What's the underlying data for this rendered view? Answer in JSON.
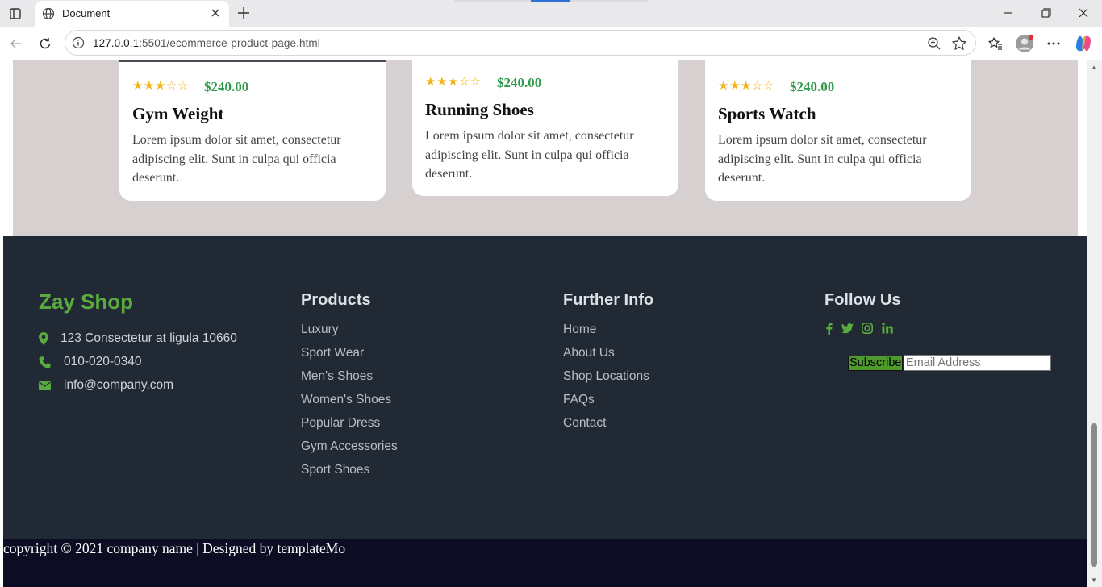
{
  "browser": {
    "tab_title": "Document",
    "url_host": "127.0.0.1",
    "url_rest": ":5501/ecommerce-product-page.html",
    "icons": [
      "tab-actions-icon",
      "globe-icon",
      "close-icon",
      "new-tab-icon",
      "minimize-icon",
      "restore-icon",
      "window-close-icon",
      "back-icon",
      "reload-icon",
      "site-info-icon",
      "zoom-icon",
      "favorite-star-icon",
      "favorites-icon",
      "profile-icon",
      "more-icon",
      "copilot-icon"
    ]
  },
  "products": [
    {
      "stars": "★★★☆☆",
      "price": "$240.00",
      "name": "Gym Weight",
      "description": "Lorem ipsum dolor sit amet, consectetur adipiscing elit. Sunt in culpa qui officia deserunt.",
      "rating": 3
    },
    {
      "stars": "★★★☆☆",
      "price": "$240.00",
      "name": "Running Shoes",
      "description": "Lorem ipsum dolor sit amet, consectetur adipiscing elit. Sunt in culpa qui officia deserunt.",
      "rating": 3
    },
    {
      "stars": "★★★☆☆",
      "price": "$240.00",
      "name": "Sports Watch",
      "description": "Lorem ipsum dolor sit amet, consectetur adipiscing elit. Sunt in culpa qui officia deserunt.",
      "rating": 3
    }
  ],
  "footer": {
    "brand": "Zay Shop",
    "contact": {
      "address": "123 Consectetur at ligula 10660",
      "phone": "010-020-0340",
      "email": "info@company.com"
    },
    "products_title": "Products",
    "products_links": [
      "Luxury",
      "Sport Wear",
      "Men's Shoes",
      "Women's Shoes",
      "Popular Dress",
      "Gym Accessories",
      "Sport Shoes"
    ],
    "info_title": "Further Info",
    "info_links": [
      "Home",
      "About Us",
      "Shop Locations",
      "FAQs",
      "Contact"
    ],
    "follow_title": "Follow Us",
    "social_icons": [
      "facebook-icon",
      "twitter-icon",
      "instagram-icon",
      "linkedin-icon"
    ],
    "subscribe_label": "Subscribe",
    "email_placeholder": "Email Address",
    "copyright": "copyright © 2021 company name | Designed by templateMo"
  },
  "colors": {
    "accent_green": "#59ab3f",
    "price_green": "#2e9a49",
    "star_yellow": "#f2b51c",
    "footer_bg": "#212934",
    "copyright_bg": "#0c0c22",
    "products_bg": "#d6d0d1"
  }
}
